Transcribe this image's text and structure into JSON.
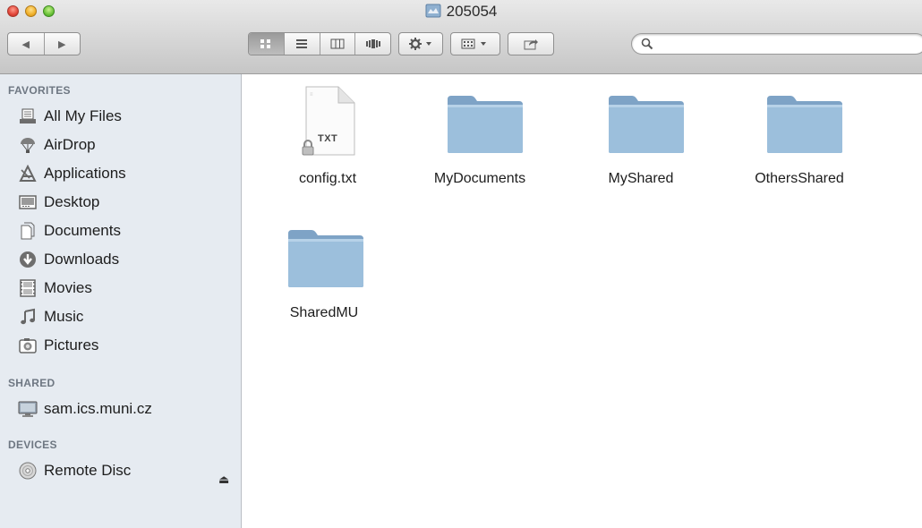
{
  "window": {
    "title": "205054"
  },
  "toolbar": {
    "back": "◀",
    "forward": "▶",
    "views": [
      "icon-view",
      "list-view",
      "column-view",
      "cover-flow-view"
    ],
    "action_menu": "gear-icon",
    "arrange_menu": "arrange-icon",
    "share": "share-icon",
    "search": {
      "value": "",
      "placeholder": ""
    }
  },
  "sidebar": {
    "favorites_header": "FAVORITES",
    "favorites": [
      {
        "label": "All My Files",
        "icon": "all-files-icon"
      },
      {
        "label": "AirDrop",
        "icon": "airdrop-icon"
      },
      {
        "label": "Applications",
        "icon": "applications-icon"
      },
      {
        "label": "Desktop",
        "icon": "desktop-icon"
      },
      {
        "label": "Documents",
        "icon": "documents-icon"
      },
      {
        "label": "Downloads",
        "icon": "downloads-icon"
      },
      {
        "label": "Movies",
        "icon": "movies-icon"
      },
      {
        "label": "Music",
        "icon": "music-icon"
      },
      {
        "label": "Pictures",
        "icon": "pictures-icon"
      }
    ],
    "shared_header": "SHARED",
    "shared": [
      {
        "label": "sam.ics.muni.cz",
        "icon": "network-computer-icon"
      }
    ],
    "devices_header": "DEVICES",
    "devices": [
      {
        "label": "Remote Disc",
        "icon": "disc-icon"
      }
    ]
  },
  "files": [
    {
      "name": "config.txt",
      "type": "text",
      "badge": "TXT",
      "locked": true
    },
    {
      "name": "MyDocuments",
      "type": "folder"
    },
    {
      "name": "MyShared",
      "type": "folder"
    },
    {
      "name": "OthersShared",
      "type": "folder"
    },
    {
      "name": "SharedMU",
      "type": "folder"
    }
  ],
  "colors": {
    "folder": "#8fb3d3",
    "folder_tab": "#7ea3c6",
    "sidebar_bg": "#e6ebf1",
    "section_header": "#6e7782"
  }
}
